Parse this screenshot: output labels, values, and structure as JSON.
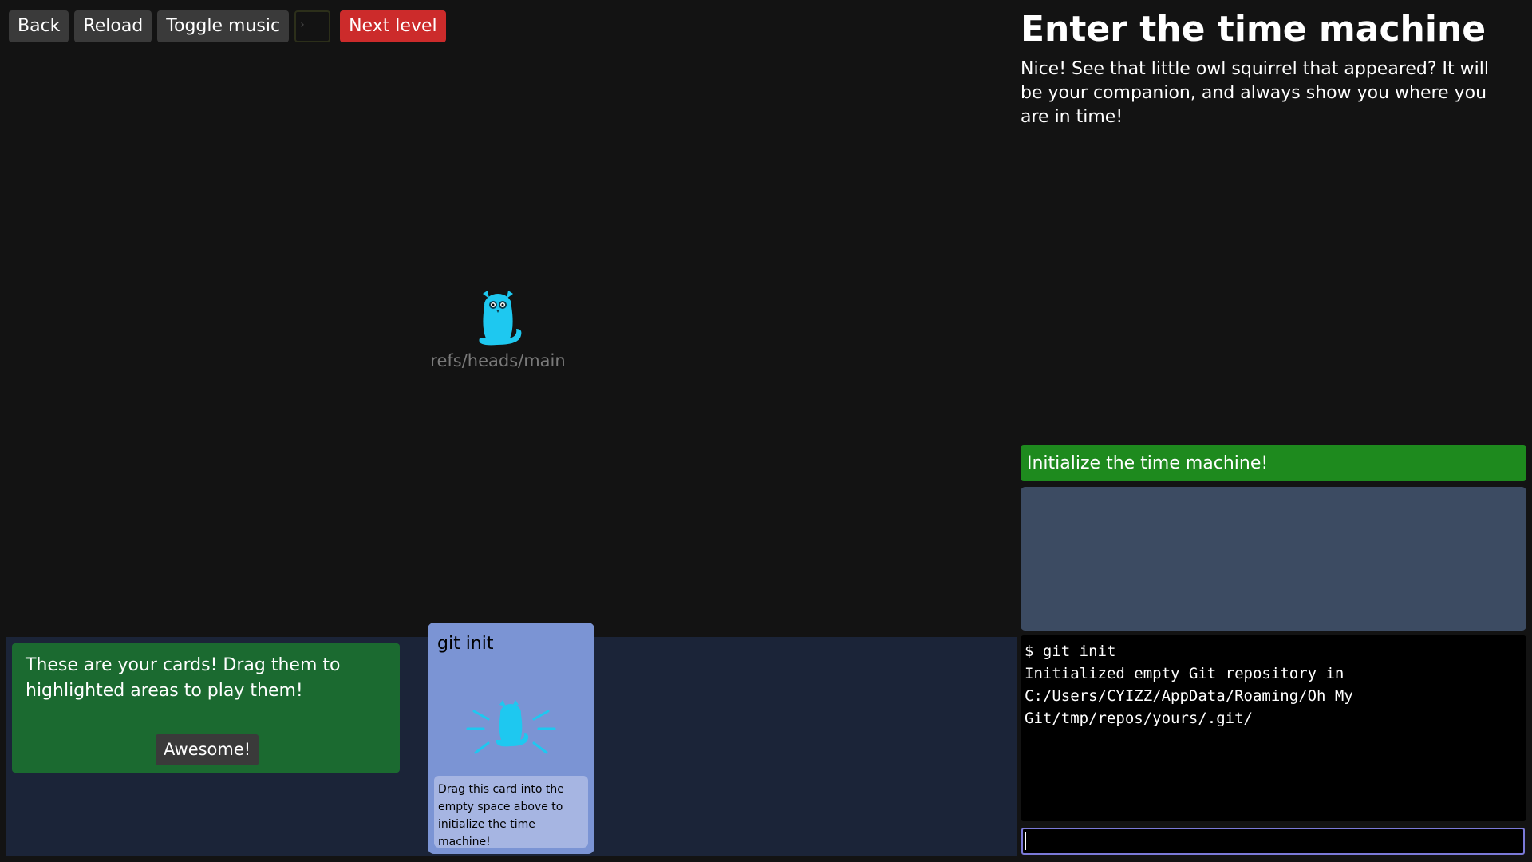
{
  "toolbar": {
    "back_label": "Back",
    "reload_label": "Reload",
    "toggle_music_label": "Toggle music",
    "terminal_glyph": "›",
    "next_level_label": "Next level"
  },
  "graph": {
    "ref_label": "refs/heads/main",
    "owl_icon": "owl-squirrel-icon"
  },
  "level": {
    "title": "Enter the time machine",
    "description": "Nice! See that little owl squirrel that appeared? It will be your companion, and always show you where you are in time!",
    "goal": "Initialize the time machine!"
  },
  "terminal": {
    "output": "$ git init\nInitialized empty Git repository in\nC:/Users/CYIZZ/AppData/Roaming/Oh My\nGit/tmp/repos/yours/.git/",
    "input_value": ""
  },
  "tutorial": {
    "text": "These are your cards! Drag them to highlighted areas to play them!",
    "button_label": "Awesome!"
  },
  "card": {
    "title": "git init",
    "description": "Drag this card into the empty space above to initialize the time machine!",
    "icon": "owl-squirrel-glow-icon"
  },
  "colors": {
    "background": "#131313",
    "owl": "#1ec8f0",
    "next_level": "#cc2b2b",
    "goal_bar": "#1e8a1e",
    "tutorial_box": "#1b6a30",
    "card": "#7b94d4",
    "drop_area": "#3c4b62",
    "card_tray": "#1b2438"
  }
}
